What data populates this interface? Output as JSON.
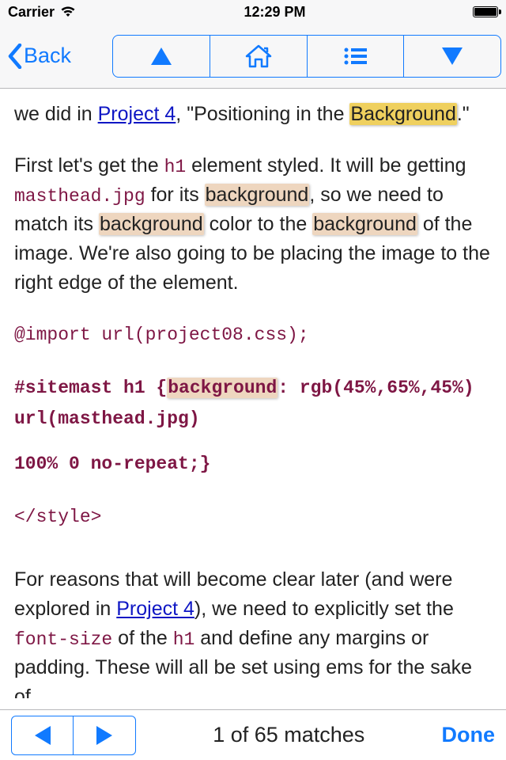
{
  "status": {
    "carrier": "Carrier",
    "time": "12:29 PM"
  },
  "nav": {
    "back": "Back"
  },
  "body": {
    "p1_a": "we did in ",
    "p1_link1": "Project 4",
    "p1_b": ", \"Positioning in the ",
    "p1_hl1": "Background",
    "p1_c": ".\"",
    "p2_a": "First let's get the ",
    "p2_code1": "h1",
    "p2_b": " element styled. It will be getting ",
    "p2_code2": "masthead.jpg",
    "p2_c": " for its ",
    "p2_hl1": "background",
    "p2_d": ", so we need to match its ",
    "p2_hl2": "background",
    "p2_e": " color to the ",
    "p2_hl3": "background",
    "p2_f": " of the image. We're also going to be placing the image to the right edge of the element.",
    "cb_l1": "@import url(project08.css);",
    "cb_l2a": "#sitemast h1 {",
    "cb_l2hl": "background",
    "cb_l2b": ":  rgb(45%,65%,45%) url(masthead.jpg)",
    "cb_l3": "   100% 0 no-repeat;}",
    "cb_l4": "</style>",
    "p3_a": "For reasons that will become clear later (and were explored in ",
    "p3_link1": "Project 4",
    "p3_b": "), we need to explicitly set the ",
    "p3_code1": "font-size",
    "p3_c": " of the ",
    "p3_code2": "h1",
    "p3_d": " and define any margins or padding. These will all be set using ems for the sake of"
  },
  "find": {
    "count": "1 of 65 matches",
    "done": "Done"
  }
}
